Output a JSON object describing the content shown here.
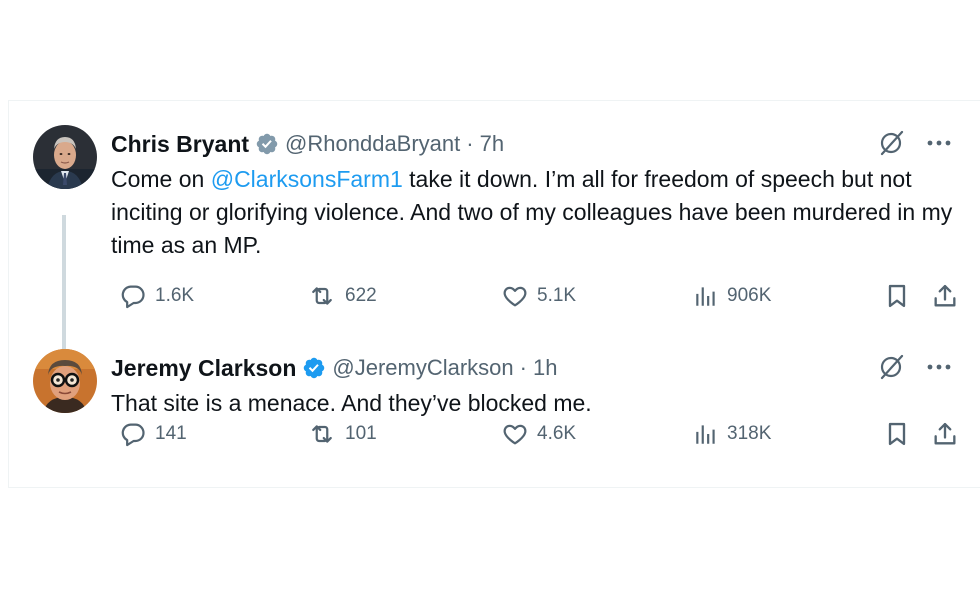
{
  "tweets": [
    {
      "author_name": "Chris Bryant",
      "verified": true,
      "badge_type": "grey-check-icon",
      "handle": "@RhonddaBryant",
      "separator": "·",
      "time": "7h",
      "text_before_mention": "Come on ",
      "mention": "@ClarksonsFarm1",
      "text_after_mention": " take it down. I’m all for freedom of speech but not inciting or glorifying violence. And two of my colleagues have been murdered in my time as an MP.",
      "stats": {
        "replies": "1.6K",
        "reposts": "622",
        "likes": "5.1K",
        "views": "906K"
      }
    },
    {
      "author_name": "Jeremy Clarkson",
      "verified": true,
      "badge_type": "blue-check-icon",
      "handle": "@JeremyClarkson",
      "separator": "·",
      "time": "1h",
      "text": "That site is a menace. And they’ve blocked me.",
      "stats": {
        "replies": "141",
        "reposts": "101",
        "likes": "4.6K",
        "views": "318K"
      }
    }
  ],
  "colors": {
    "text_primary": "#0f1419",
    "text_secondary": "#536471",
    "link": "#1d9bf0",
    "verified_blue": "#1d9bf0",
    "verified_grey": "#829aab",
    "thread_line": "#cfd9de"
  },
  "icons": [
    "grok-icon",
    "more-icon",
    "reply-icon",
    "repost-icon",
    "like-icon",
    "views-icon",
    "bookmark-icon",
    "share-icon"
  ]
}
